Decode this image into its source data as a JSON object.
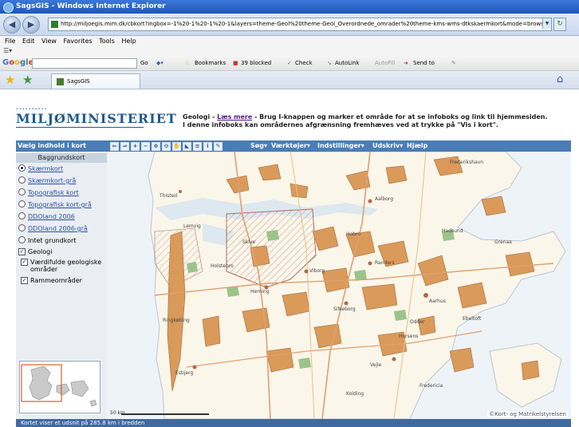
{
  "browser": {
    "title": "SagsGIS - Windows Internet Explorer",
    "address": "http://miljoegis.mim.dk/cbkort?ingbox=-1%20-1%20-1%20-1&layers=theme-Geol%20theme-Geol_Overordnede_omrader%20theme-kms-wms-dtkskaermkort&mode=browsebz",
    "menu": [
      "File",
      "Edit",
      "View",
      "Favorites",
      "Tools",
      "Help"
    ],
    "google_toolbar": {
      "label": "Google",
      "go": "Go",
      "bookmarks": "Bookmarks",
      "blocked": "39 blocked",
      "check": "Check",
      "autolink": "AutoLink",
      "autofill": "AutoFill",
      "send_to": "Send to"
    },
    "tab_title": "SagsGIS"
  },
  "page": {
    "logo": "MILJØMINISTERIET",
    "logo_dots": "••••••••••",
    "info_line1_prefix": "Geologi - ",
    "info_link": "Læs mere",
    "info_line1_suffix": " - Brug I-knappen og marker et område for at se infoboks og link til hjemmesiden.",
    "info_line2": "I denne infoboks kan områdernes afgrænsning fremhæves ved at trykke på \"Vis i kort\"."
  },
  "app": {
    "panel_title": "Vælg indhold i kort",
    "menu": [
      "Søg▾",
      "Værktøjer▾",
      "Indstillinger▾",
      "Udskriv▾",
      "Hjælp"
    ],
    "background_head": "Baggrundskort",
    "background_options": [
      {
        "label": "Skærmkort",
        "selected": true,
        "link": true
      },
      {
        "label": "Skærmkort-grå",
        "selected": false,
        "link": true
      },
      {
        "label": "Topografisk kort",
        "selected": false,
        "link": true
      },
      {
        "label": "Topografisk kort-grå",
        "selected": false,
        "link": true
      },
      {
        "label": "DDOland 2006",
        "selected": false,
        "link": true
      },
      {
        "label": "DDOland 2006-grå",
        "selected": false,
        "link": true
      },
      {
        "label": "Intet grundkort",
        "selected": false,
        "link": false
      }
    ],
    "geology_label": "Geologi",
    "layers": [
      {
        "label": "Værdifulde geologiske områder",
        "checked": true
      },
      {
        "label": "Rammeområder",
        "checked": true
      }
    ],
    "status": "Kortet viser et udsnit på 285.8 km i bredden",
    "scale_label": "50 km",
    "attribution": "©Kort- og Matrikelstyrelsen"
  },
  "map_labels": [
    "Thisted",
    "Hobro",
    "Aalborg",
    "Viborg",
    "Herning",
    "Silkeborg",
    "Aarhus",
    "Randers",
    "Grenaa",
    "Vejle",
    "Horsens",
    "Ringkøbing",
    "Esbjerg",
    "Frederikshavn",
    "Hadsund",
    "Skive",
    "Lemvig",
    "Holstebro",
    "Ebeltoft",
    "Odder",
    "Fredericia",
    "Kolding"
  ]
}
